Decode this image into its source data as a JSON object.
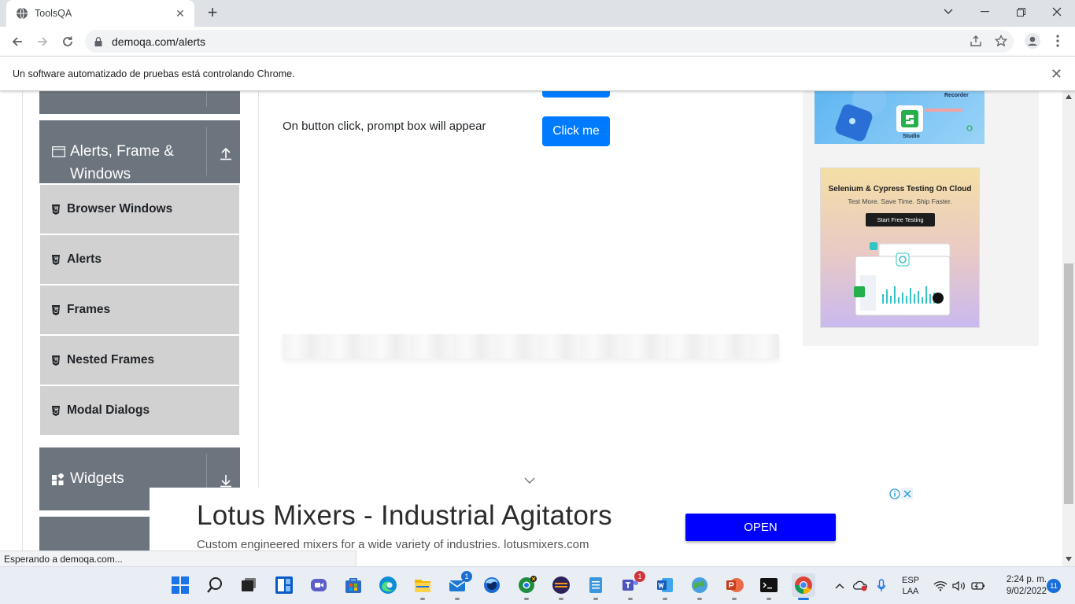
{
  "browser": {
    "tab_title": "ToolsQA",
    "url": "demoqa.com/alerts",
    "infobar_text": "Un software automatizado de pruebas está controlando Chrome.",
    "status_text": "Esperando a demoqa.com..."
  },
  "sidebar": {
    "group_alerts_title_line1": "Alerts, Frame &",
    "group_alerts_title_line2": "Windows",
    "items": [
      {
        "label": "Browser Windows"
      },
      {
        "label": "Alerts"
      },
      {
        "label": "Frames"
      },
      {
        "label": "Nested Frames"
      },
      {
        "label": "Modal Dialogs"
      }
    ],
    "group_widgets_title": "Widgets"
  },
  "main": {
    "prompt_text": "On button click, prompt box will appear",
    "prompt_button": "Click me"
  },
  "right_ads": {
    "top_label_1": "Recorder",
    "top_label_2": "Studio",
    "bottom_title": "Selenium & Cypress Testing On Cloud",
    "bottom_subtitle": "Test More. Save Time. Ship Faster.",
    "bottom_cta": "Start Free Testing"
  },
  "banner": {
    "title": "Lotus Mixers - Industrial Agitators",
    "subtitle": "Custom engineered mixers for a wide variety of industries. lotusmixers.com",
    "open_button": "OPEN"
  },
  "taskbar": {
    "mail_badge": "1",
    "teams_badge": "1",
    "lang_line1": "ESP",
    "lang_line2": "LAA",
    "time": "2:24 p. m.",
    "date": "9/02/2022",
    "notification_count": "11"
  },
  "colors": {
    "primary_button": "#007bff",
    "sidebar_header": "#6c757d",
    "sidebar_item": "#d1d1d1",
    "banner_button": "#0000ff"
  }
}
